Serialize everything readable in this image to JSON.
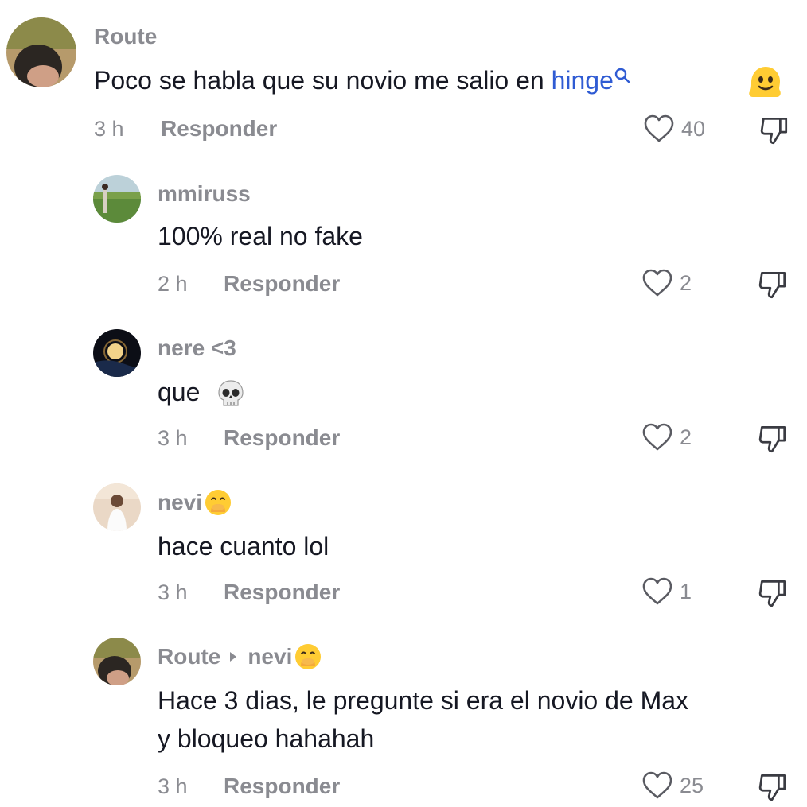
{
  "comments": [
    {
      "username": "Route",
      "text_prefix": "Poco se habla que su novio me salio en ",
      "link_text": "hinge",
      "time": "3 h",
      "reply_label": "Responder",
      "likes": "40"
    },
    {
      "username": "mmiruss",
      "text": "100% real no fake",
      "time": "2 h",
      "reply_label": "Responder",
      "likes": "2"
    },
    {
      "username": "nere <3",
      "text": "que",
      "time": "3 h",
      "reply_label": "Responder",
      "likes": "2"
    },
    {
      "username": "nevi",
      "text": "hace cuanto lol",
      "time": "3 h",
      "reply_label": "Responder",
      "likes": "1"
    },
    {
      "username": "Route",
      "reply_to": "nevi",
      "text_line1": "Hace 3 dias, le pregunte si era el novio de Max",
      "text_line2": "y bloqueo hahahah",
      "time": "3 h",
      "reply_label": "Responder",
      "likes": "25"
    }
  ],
  "icons": {
    "like": "heart-outline-icon",
    "dislike": "thumbs-down-icon",
    "search": "search-icon"
  },
  "colors": {
    "link": "#2f5bd3",
    "muted": "#8a8b91",
    "text": "#161823"
  }
}
